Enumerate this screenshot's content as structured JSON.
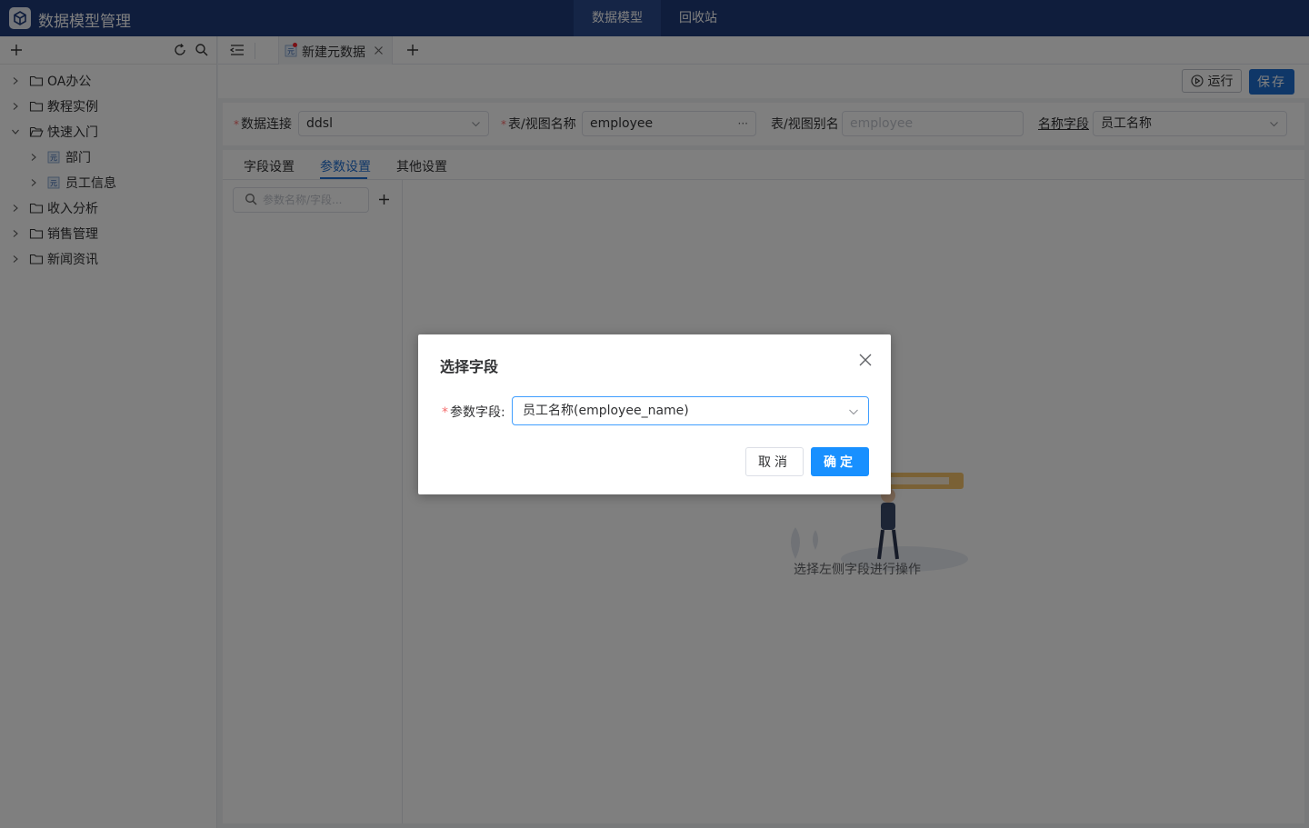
{
  "header": {
    "app_title": "数据模型管理",
    "nav": [
      "数据模型",
      "回收站"
    ]
  },
  "sidebar": {
    "tree": [
      {
        "label": "OA办公",
        "type": "folder",
        "expanded": false
      },
      {
        "label": "教程实例",
        "type": "folder",
        "expanded": false
      },
      {
        "label": "快速入门",
        "type": "folder",
        "expanded": true
      },
      {
        "label": "部门",
        "type": "model"
      },
      {
        "label": "员工信息",
        "type": "model"
      },
      {
        "label": "收入分析",
        "type": "folder",
        "expanded": false
      },
      {
        "label": "销售管理",
        "type": "folder",
        "expanded": false
      },
      {
        "label": "新闻资讯",
        "type": "folder",
        "expanded": false
      }
    ]
  },
  "tabs": {
    "active_label": "新建元数据",
    "model_badge": "元"
  },
  "toolbar": {
    "run_label": "运行",
    "save_label": "保存"
  },
  "form": {
    "connection_label": "数据连接",
    "connection_value": "ddsl",
    "table_label": "表/视图名称",
    "table_value": "employee",
    "table_more": "···",
    "alias_label": "表/视图别名",
    "alias_placeholder": "employee",
    "name_field_label": "名称字段",
    "name_field_value": "员工名称"
  },
  "subtabs": [
    "字段设置",
    "参数设置",
    "其他设置"
  ],
  "param_search": {
    "placeholder": "参数名称/字段..."
  },
  "empty_state": {
    "text": "选择左侧字段进行操作"
  },
  "dialog": {
    "title": "选择字段",
    "field_label": "参数字段:",
    "field_value": "员工名称(employee_name)",
    "cancel_label": "取消",
    "ok_label": "确定"
  },
  "colors": {
    "header_bg": "#1e3a78",
    "primary": "#1890ff",
    "save_btn": "#1f6fd1",
    "required": "#f56c6c"
  }
}
